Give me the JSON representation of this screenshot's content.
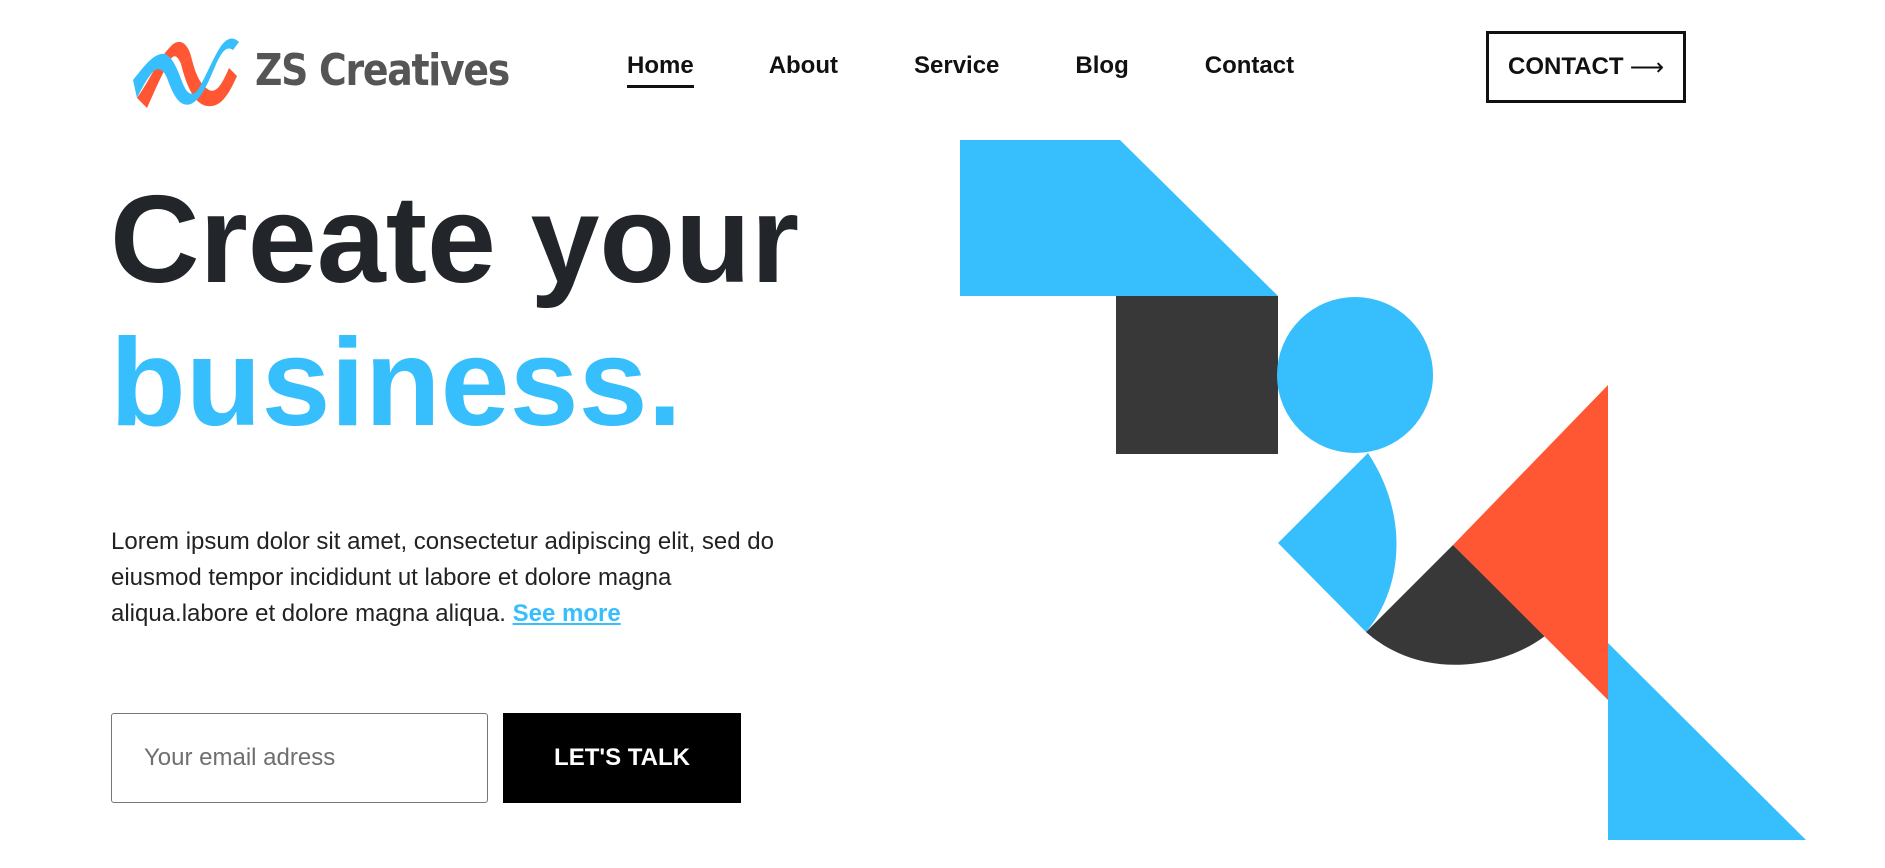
{
  "brand": {
    "name": "ZS Creatives",
    "logo_icon": "wave-logo-icon",
    "colors": {
      "primary": "#36bffc",
      "accent": "#ff5733",
      "dark": "#383838",
      "text": "#22252a"
    }
  },
  "nav": {
    "items": [
      {
        "label": "Home",
        "active": true
      },
      {
        "label": "About",
        "active": false
      },
      {
        "label": "Service",
        "active": false
      },
      {
        "label": "Blog",
        "active": false
      },
      {
        "label": "Contact",
        "active": false
      }
    ],
    "cta_label": "CONTACT",
    "cta_icon": "arrow-right-icon"
  },
  "hero": {
    "headline_line1": "Create your",
    "headline_line2": "business.",
    "description": "Lorem ipsum dolor sit amet, consectetur adipiscing elit, sed do eiusmod tempor incididunt ut labore et dolore magna aliqua.labore et dolore magna aliqua.",
    "see_more_label": "See more",
    "email_placeholder": "Your email adress",
    "submit_label": "LET'S TALK"
  }
}
